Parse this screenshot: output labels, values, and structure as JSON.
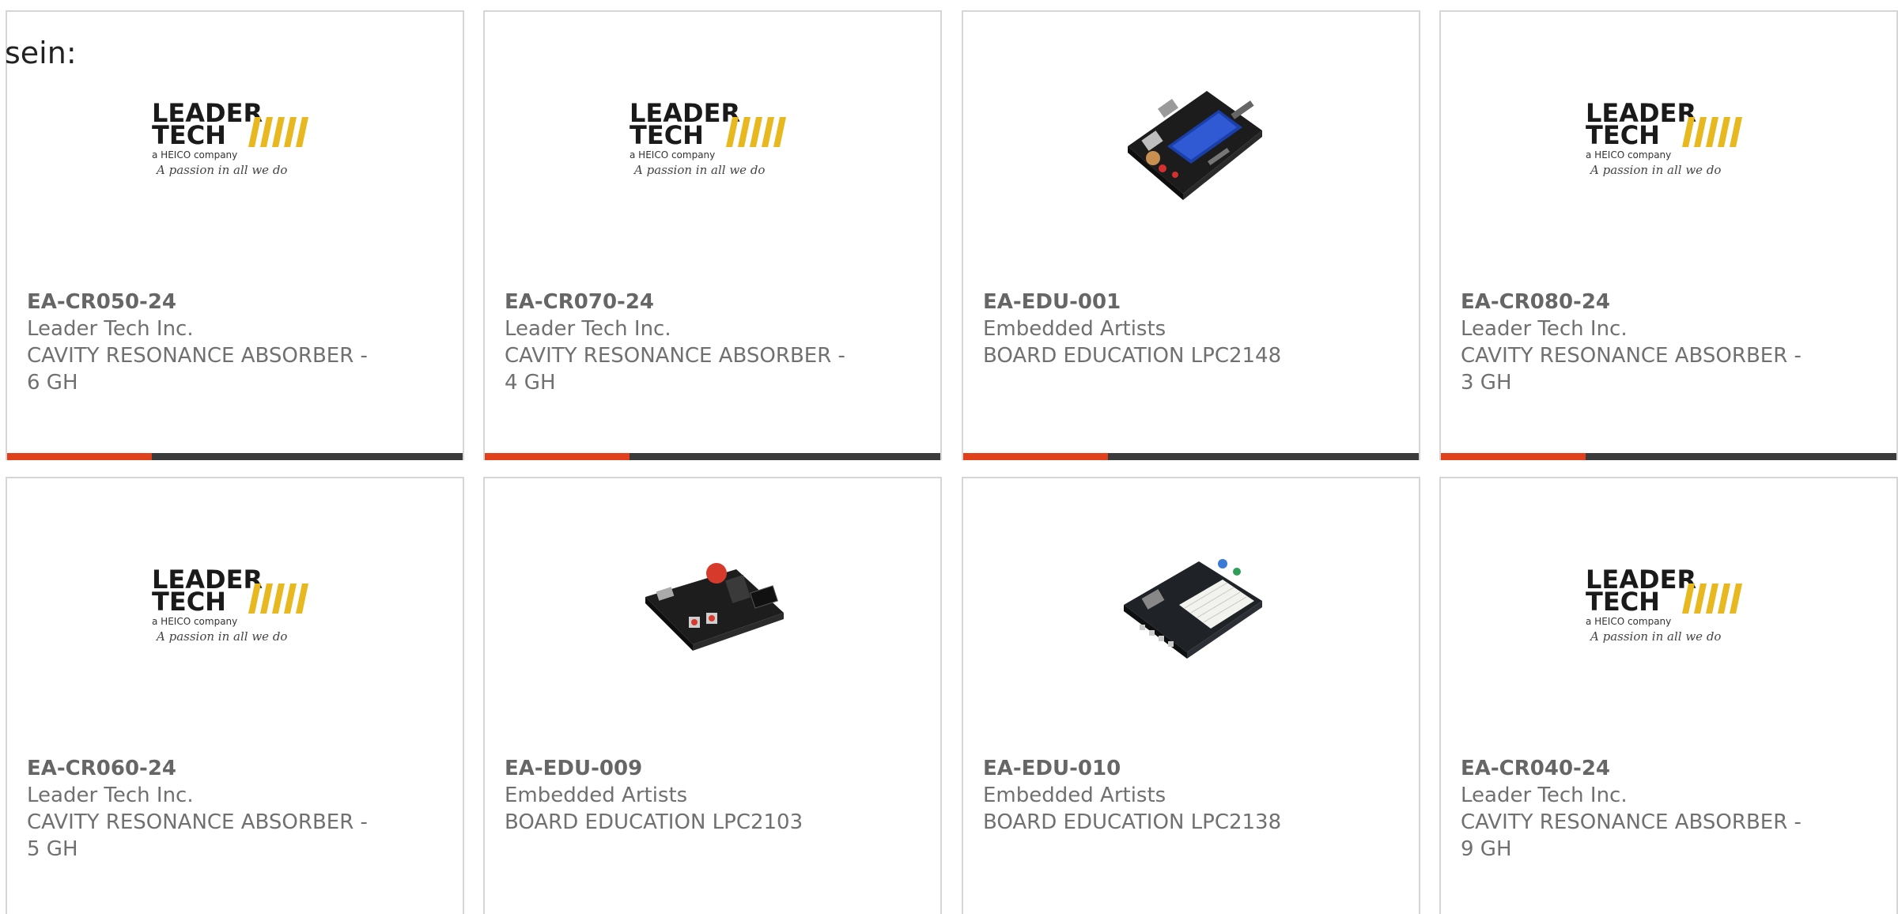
{
  "intro": "sein:",
  "colors": {
    "accent": "#e0401c",
    "bar_dark": "#3b3b3b",
    "leader_yellow": "#e8b820",
    "text_grey": "#707070"
  },
  "products": [
    {
      "sku": "EA-CR050-24",
      "manufacturer": "Leader Tech Inc.",
      "desc_line1": "CAVITY RESONANCE ABSORBER -",
      "desc_line2": "6 GH",
      "image": "leader-tech-logo",
      "logo": {
        "line1": "LEADER",
        "line2": "TECH",
        "tagline": "a HEICO company",
        "script": "A passion in all we do"
      }
    },
    {
      "sku": "EA-CR070-24",
      "manufacturer": "Leader Tech Inc.",
      "desc_line1": "CAVITY RESONANCE ABSORBER -",
      "desc_line2": "4 GH",
      "image": "leader-tech-logo",
      "logo": {
        "line1": "LEADER",
        "line2": "TECH",
        "tagline": "a HEICO company",
        "script": "A passion in all we do"
      }
    },
    {
      "sku": "EA-EDU-001",
      "manufacturer": "Embedded Artists",
      "desc_line1": "BOARD EDUCATION LPC2148",
      "desc_line2": "",
      "image": "circuit-board-lcd"
    },
    {
      "sku": "EA-CR080-24",
      "manufacturer": "Leader Tech Inc.",
      "desc_line1": "CAVITY RESONANCE ABSORBER -",
      "desc_line2": "3 GH",
      "image": "leader-tech-logo",
      "logo": {
        "line1": "LEADER",
        "line2": "TECH",
        "tagline": "a HEICO company",
        "script": "A passion in all we do"
      }
    },
    {
      "sku": "EA-CR060-24",
      "manufacturer": "Leader Tech Inc.",
      "desc_line1": "CAVITY RESONANCE ABSORBER -",
      "desc_line2": "5 GH",
      "image": "leader-tech-logo",
      "logo": {
        "line1": "LEADER",
        "line2": "TECH",
        "tagline": "a HEICO company",
        "script": "A passion in all we do"
      }
    },
    {
      "sku": "EA-EDU-009",
      "manufacturer": "Embedded Artists",
      "desc_line1": "BOARD EDUCATION LPC2103",
      "desc_line2": "",
      "image": "circuit-board-small"
    },
    {
      "sku": "EA-EDU-010",
      "manufacturer": "Embedded Artists",
      "desc_line1": "BOARD EDUCATION LPC2138",
      "desc_line2": "",
      "image": "circuit-board-breadboard"
    },
    {
      "sku": "EA-CR040-24",
      "manufacturer": "Leader Tech Inc.",
      "desc_line1": "CAVITY RESONANCE ABSORBER -",
      "desc_line2": "9 GH",
      "image": "leader-tech-logo",
      "logo": {
        "line1": "LEADER",
        "line2": "TECH",
        "tagline": "a HEICO company",
        "script": "A passion in all we do"
      }
    }
  ]
}
